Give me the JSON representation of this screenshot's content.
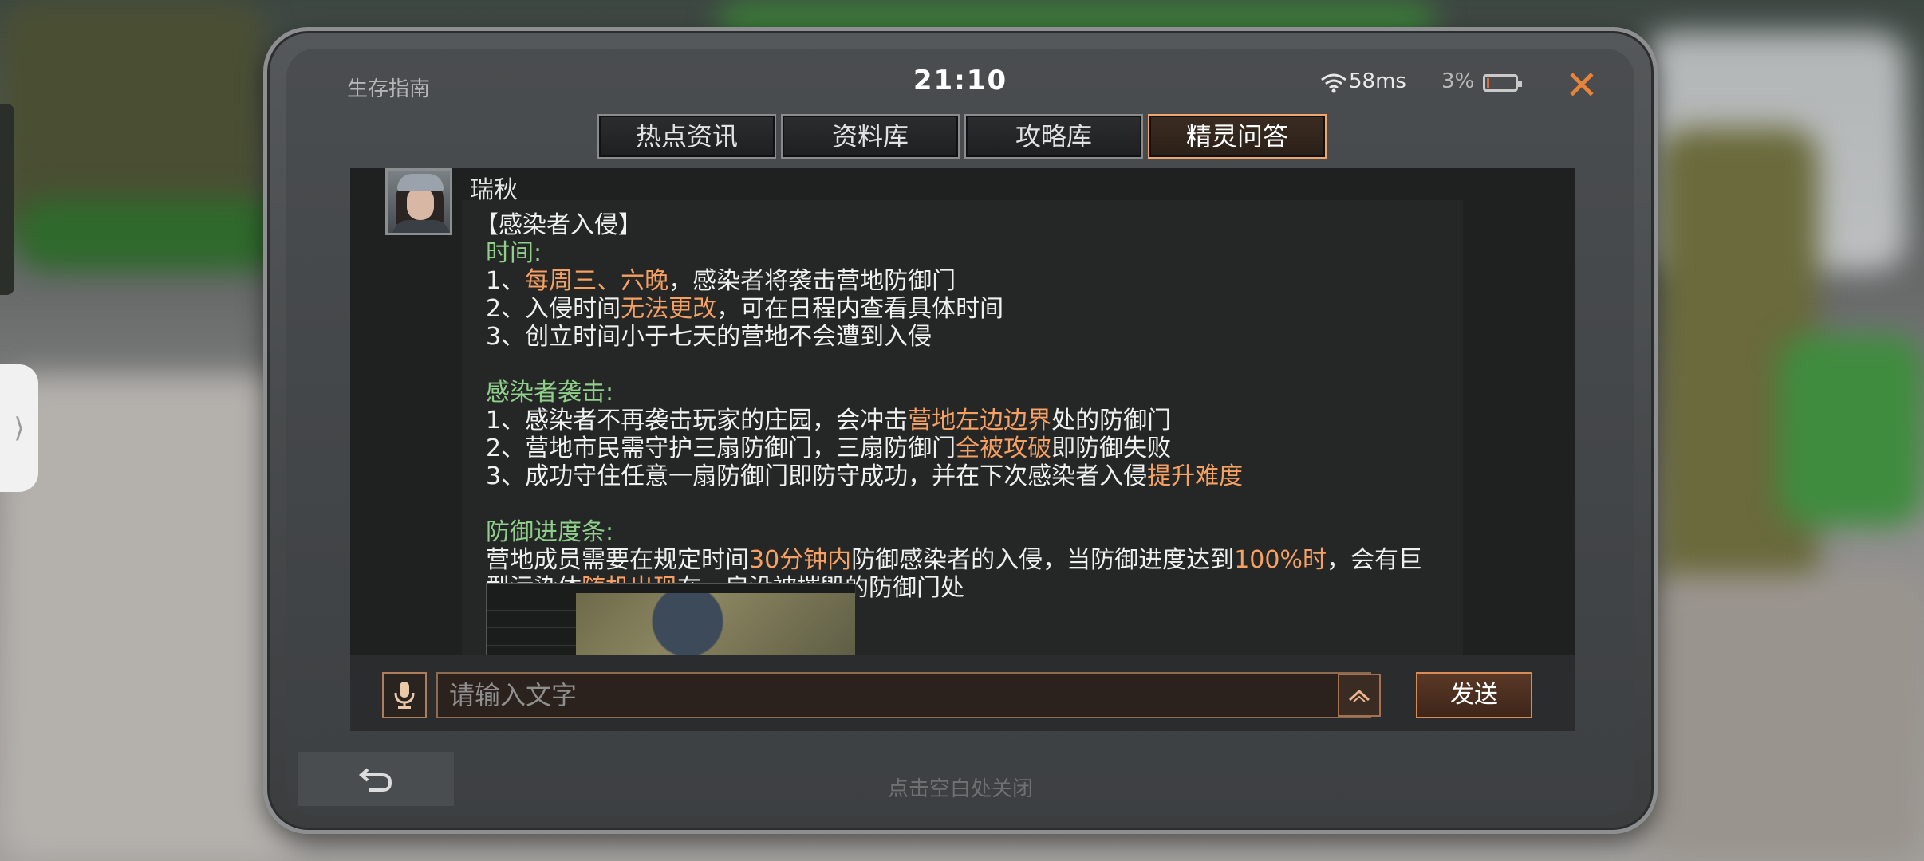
{
  "status": {
    "app_title": "生存指南",
    "time": "21:10",
    "ping": "58ms",
    "battery": "3%",
    "close_icon": "✕"
  },
  "tabs": [
    {
      "label": "热点资讯",
      "active": false
    },
    {
      "label": "资料库",
      "active": false
    },
    {
      "label": "攻略库",
      "active": false
    },
    {
      "label": "精灵问答",
      "active": true
    }
  ],
  "message": {
    "sender": "瑞秋",
    "title": "【感染者入侵】",
    "time_heading": "时间:",
    "time_items": [
      {
        "prefix": "1、",
        "highlight": "每周三、六晚",
        "suffix": "，感染者将袭击营地防御门"
      },
      {
        "prefix": "2、入侵时间",
        "highlight": "无法更改",
        "suffix": "，可在日程内查看具体时间"
      },
      {
        "prefix": "3、创立时间小于七天的营地不会遭到入侵",
        "highlight": "",
        "suffix": ""
      }
    ],
    "attack_heading": "感染者袭击:",
    "attack_items": [
      {
        "prefix": "1、感染者不再袭击玩家的庄园，会冲击",
        "highlight": "营地左边边界",
        "suffix": "处的防御门"
      },
      {
        "prefix": "2、营地市民需守护三扇防御门，三扇防御门",
        "highlight": "全被攻破",
        "suffix": "即防御失败"
      },
      {
        "prefix": "3、成功守住任意一扇防御门即防守成功，并在下次感染者入侵",
        "highlight": "提升难度",
        "suffix": ""
      }
    ],
    "progress_heading": "防御进度条:",
    "progress_text": {
      "p1": "营地成员需要在规定时间",
      "h1": "30分钟内",
      "p2": "防御感染者的入侵，当防御进度达到",
      "h2": "100%时",
      "p3": "，会有巨型污染体",
      "h3": "随机出现",
      "p4": "在一扇没被摧毁的防御门处"
    }
  },
  "input": {
    "placeholder": "请输入文字",
    "send_label": "发送"
  },
  "bottom": {
    "hint": "点击空白处关闭"
  },
  "side_handle": "⟩",
  "colors": {
    "accent_orange": "#f6a063",
    "heading_green": "#8fcf8a",
    "close_orange": "#e8843a"
  }
}
